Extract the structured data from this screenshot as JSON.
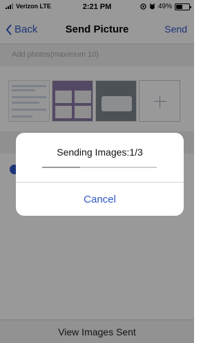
{
  "status_bar": {
    "carrier": "Verizon LTE",
    "time": "2:21 PM",
    "battery": "49%",
    "battery_level": 0.49
  },
  "nav": {
    "back_label": "Back",
    "title": "Send Picture",
    "send_label": "Send"
  },
  "photos": {
    "placeholder": "Add photos(maximum 10)"
  },
  "bottom": {
    "label": "View Images Sent"
  },
  "alert": {
    "title": "Sending Images:1/3",
    "progress": 0.33,
    "cancel_label": "Cancel"
  },
  "colors": {
    "accent": "#2f57c8"
  },
  "icons": [
    "back-chevron-icon",
    "signal-icon",
    "location-icon",
    "alarm-icon",
    "battery-icon",
    "add-icon"
  ]
}
